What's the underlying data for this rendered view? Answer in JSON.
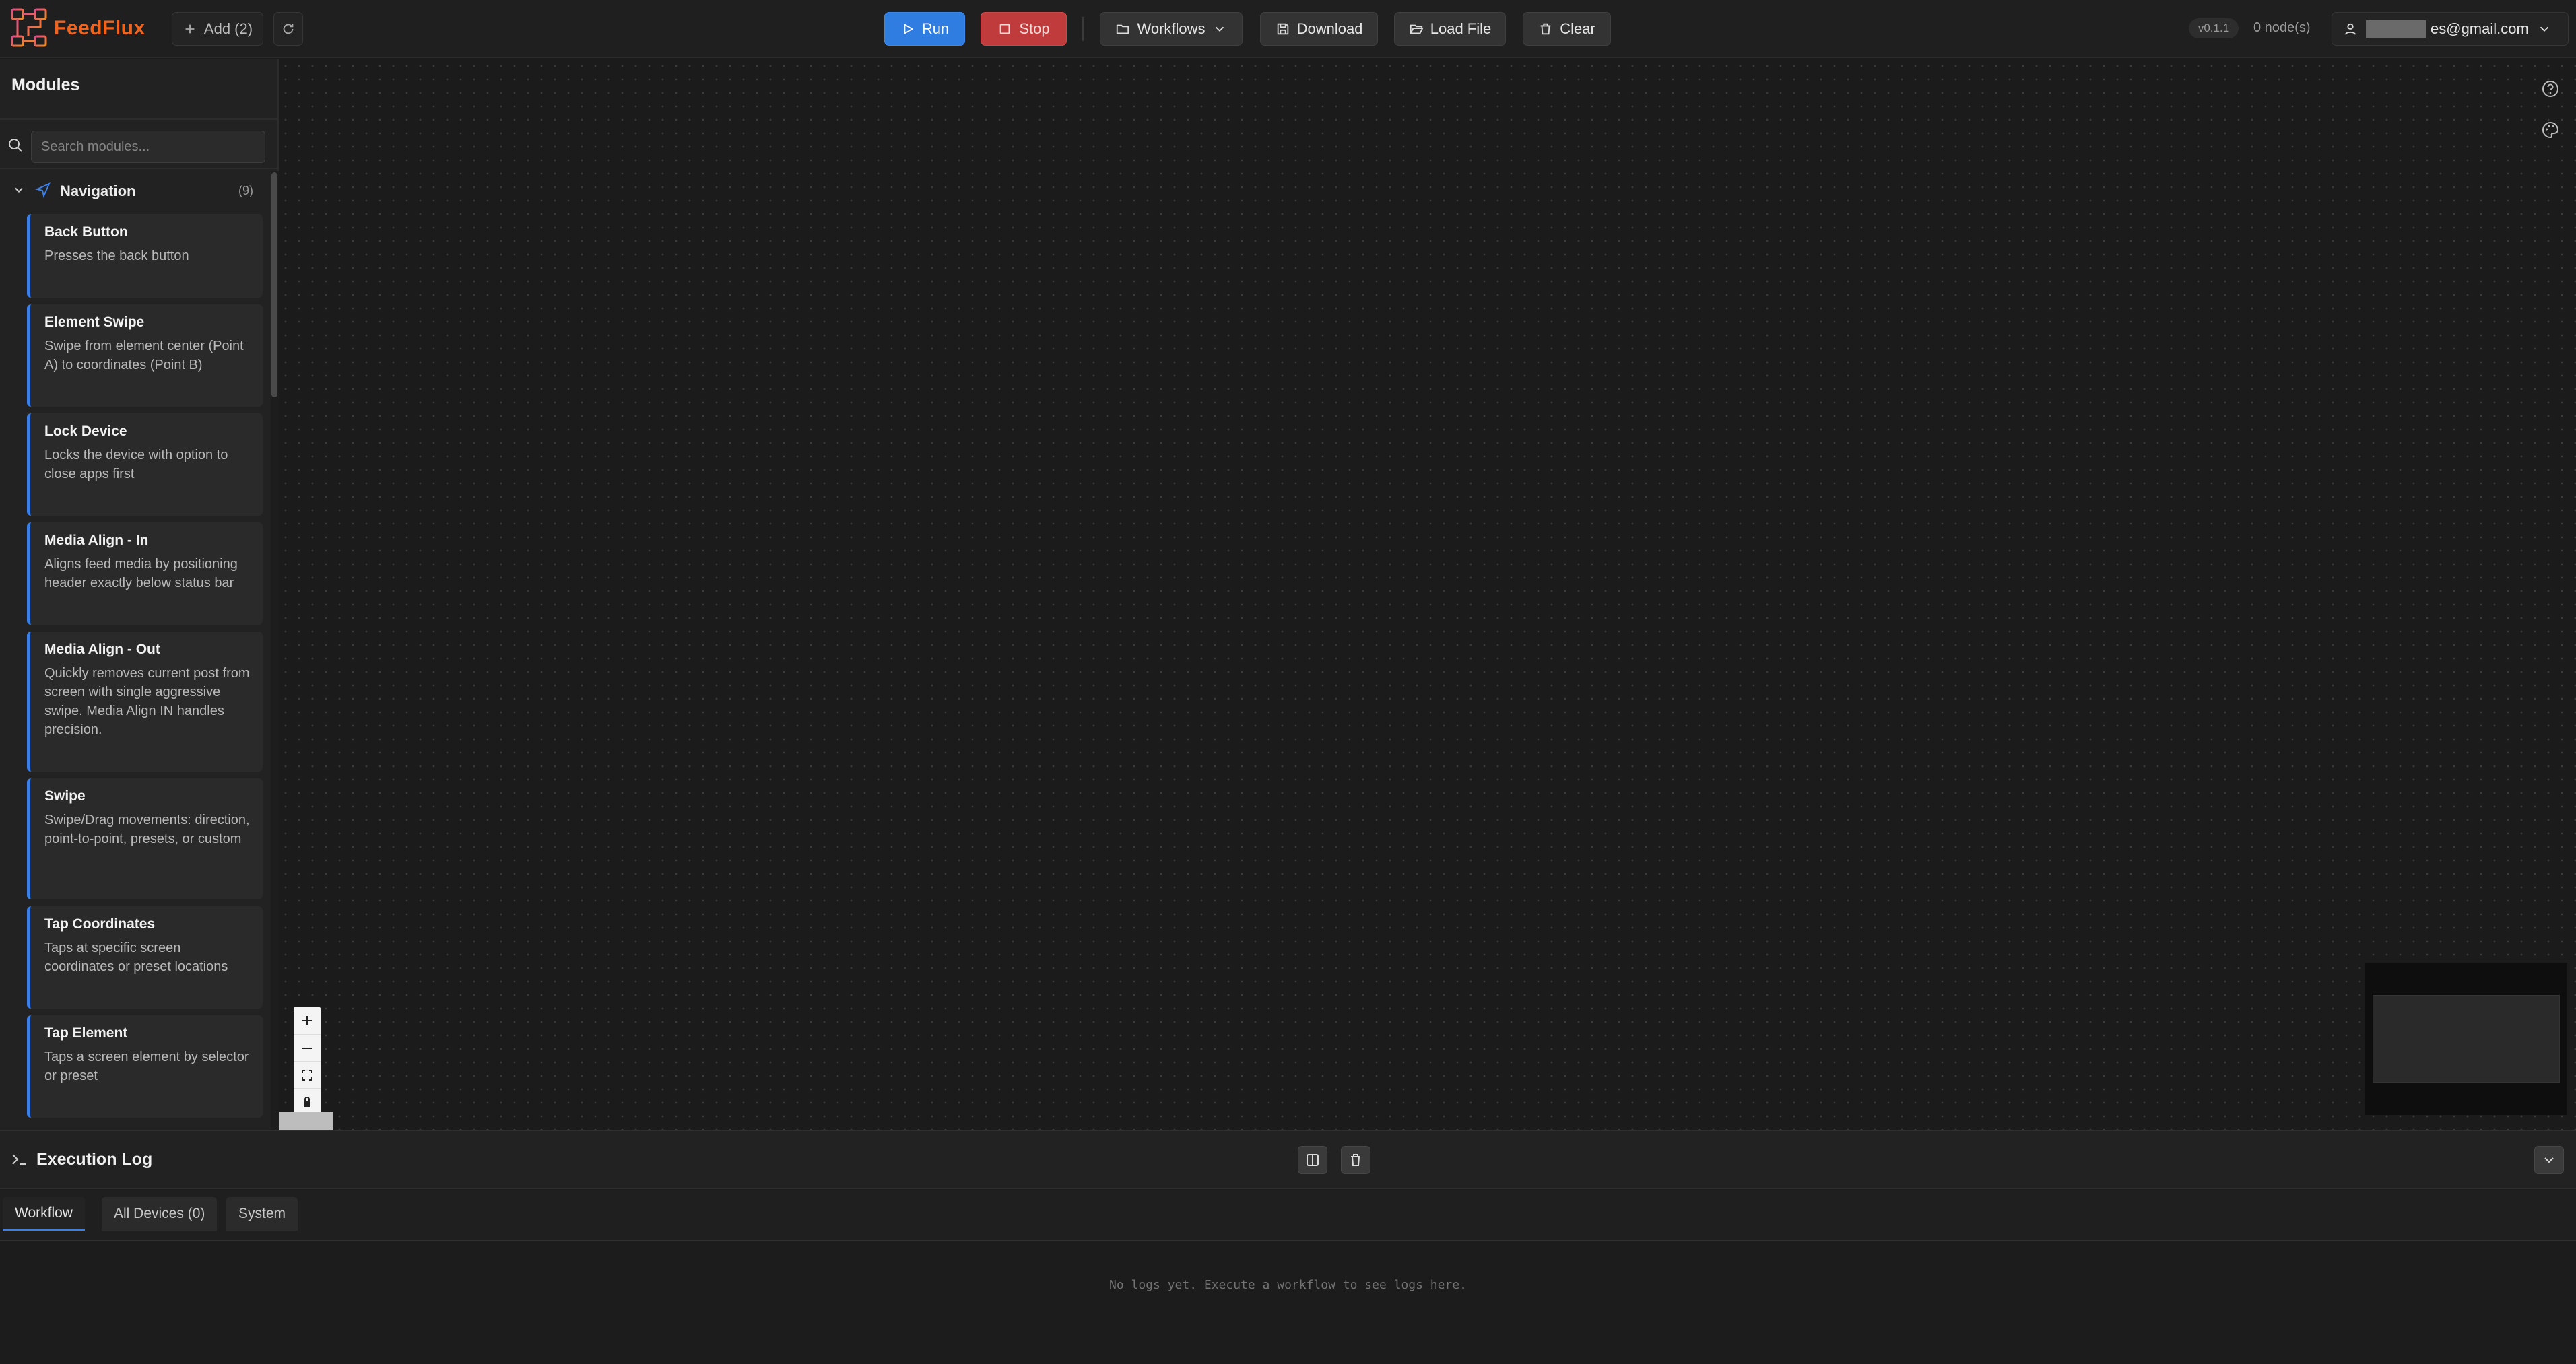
{
  "app": {
    "name": "FeedFlux",
    "version": "v0.1.1",
    "node_count": "0 node(s)"
  },
  "toolbar": {
    "add_label": "Add (2)",
    "run_label": "Run",
    "stop_label": "Stop",
    "workflows_label": "Workflows",
    "download_label": "Download",
    "load_file_label": "Load File",
    "clear_label": "Clear",
    "user_email": "es@gmail.com"
  },
  "sidebar": {
    "title": "Modules",
    "search_placeholder": "Search modules...",
    "category": {
      "label": "Navigation",
      "count": "(9)"
    },
    "modules": [
      {
        "title": "Back Button",
        "desc": "Presses the back button"
      },
      {
        "title": "Element Swipe",
        "desc": "Swipe from element center (Point A) to coordinates (Point B)"
      },
      {
        "title": "Lock Device",
        "desc": "Locks the device with option to close apps first"
      },
      {
        "title": "Media Align - In",
        "desc": "Aligns feed media by positioning header exactly below status bar"
      },
      {
        "title": "Media Align - Out",
        "desc": "Quickly removes current post from screen with single aggressive swipe. Media Align IN handles precision."
      },
      {
        "title": "Swipe",
        "desc": "Swipe/Drag movements: direction, point-to-point, presets, or custom"
      },
      {
        "title": "Tap Coordinates",
        "desc": "Taps at specific screen coordinates or preset locations"
      },
      {
        "title": "Tap Element",
        "desc": "Taps a screen element by selector or preset"
      }
    ]
  },
  "log": {
    "title": "Execution Log",
    "tabs": [
      "Workflow",
      "All Devices (0)",
      "System"
    ],
    "empty_message": "No logs yet. Execute a workflow to see logs here."
  },
  "colors": {
    "accent": "#3b7fe8",
    "brand": "#f0641e",
    "run": "#2f7de1",
    "stop": "#c03b3b"
  },
  "icons": [
    "refresh-icon",
    "play-icon",
    "stop-icon",
    "folder-icon",
    "chevron-down-icon",
    "save-icon",
    "folder-open-icon",
    "trash-icon",
    "user-icon",
    "search-icon",
    "navigation-icon",
    "help-icon",
    "palette-icon",
    "terminal-icon",
    "split-view-icon"
  ]
}
